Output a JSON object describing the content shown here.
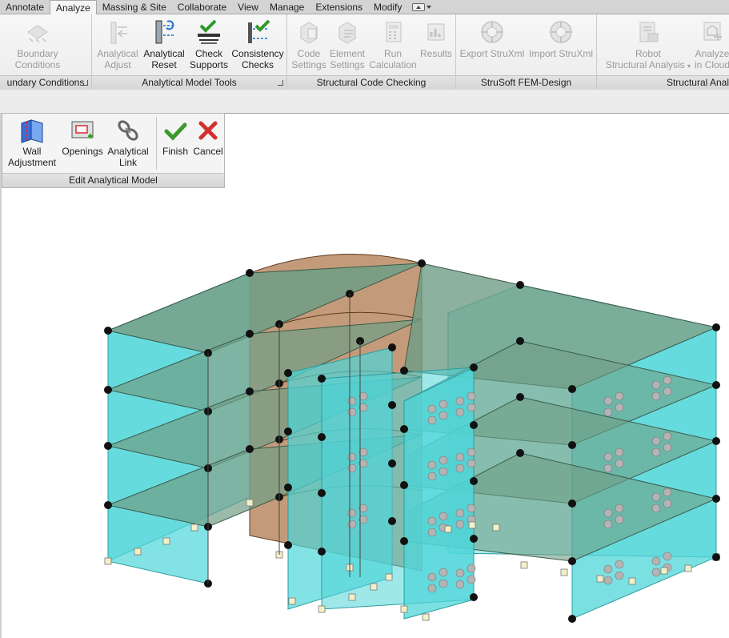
{
  "tabs": [
    {
      "label": "Annotate",
      "active": false
    },
    {
      "label": "Analyze",
      "active": true
    },
    {
      "label": "Massing & Site",
      "active": false
    },
    {
      "label": "Collaborate",
      "active": false
    },
    {
      "label": "View",
      "active": false
    },
    {
      "label": "Manage",
      "active": false
    },
    {
      "label": "Extensions",
      "active": false
    },
    {
      "label": "Modify",
      "active": false
    }
  ],
  "ribbon": {
    "boundary": {
      "title": "undary Conditions",
      "buttons": [
        {
          "line1": "Boundary",
          "line2": "Conditions",
          "icon": "boundary-conditions-icon",
          "enabled": false
        }
      ]
    },
    "analytical_tools": {
      "title": "Analytical Model Tools",
      "buttons": [
        {
          "line1": "Analytical",
          "line2": "Adjust",
          "icon": "analytical-adjust-icon",
          "enabled": false
        },
        {
          "line1": "Analytical",
          "line2": "Reset",
          "icon": "analytical-reset-icon",
          "enabled": true
        },
        {
          "line1": "Check",
          "line2": "Supports",
          "icon": "check-supports-icon",
          "enabled": true
        },
        {
          "line1": "Consistency",
          "line2": "Checks",
          "icon": "consistency-checks-icon",
          "enabled": true
        }
      ]
    },
    "code_checking": {
      "title": "Structural Code Checking",
      "buttons": [
        {
          "line1": "Code",
          "line2": "Settings",
          "icon": "code-settings-icon",
          "enabled": false
        },
        {
          "line1": "Element",
          "line2": "Settings",
          "icon": "element-settings-icon",
          "enabled": false
        },
        {
          "line1": "Run",
          "line2": "Calculation",
          "icon": "run-calculation-icon",
          "enabled": false
        },
        {
          "line1": "Results",
          "line2": "",
          "icon": "results-icon",
          "enabled": false
        }
      ]
    },
    "strusoft": {
      "title": "StruSoft FEM-Design",
      "buttons": [
        {
          "line1": "Export StruXml",
          "line2": "",
          "icon": "export-struxml-icon",
          "enabled": false
        },
        {
          "line1": "Import StruXml",
          "line2": "",
          "icon": "import-struxml-icon",
          "enabled": false
        }
      ]
    },
    "structural_analysis": {
      "title": "Structural Anal",
      "buttons": [
        {
          "line1": "Robot",
          "line2": "Structural Analysis",
          "icon": "robot-structural-analysis-icon",
          "enabled": false
        },
        {
          "line1": "Analyze",
          "line2": "in Cloud",
          "icon": "analyze-in-cloud-icon",
          "enabled": false
        }
      ]
    }
  },
  "context_ribbon": {
    "title": "Edit Analytical Model",
    "buttons": [
      {
        "line1": "Wall",
        "line2": "Adjustment",
        "icon": "wall-adjustment-icon"
      },
      {
        "line1": "Openings",
        "line2": "",
        "icon": "openings-icon"
      },
      {
        "line1": "Analytical",
        "line2": "Link",
        "icon": "analytical-link-icon"
      },
      {
        "line1": "Finish",
        "line2": "",
        "icon": "finish-check-icon"
      },
      {
        "line1": "Cancel",
        "line2": "",
        "icon": "cancel-x-icon"
      }
    ]
  },
  "colors": {
    "wall_cyan": "#4fd6d8",
    "floor_green": "#6f9e86",
    "core_brown": "#b07a4e",
    "node_black": "#111111",
    "finish_green": "#3a9a2a",
    "cancel_red": "#d32f2f"
  }
}
